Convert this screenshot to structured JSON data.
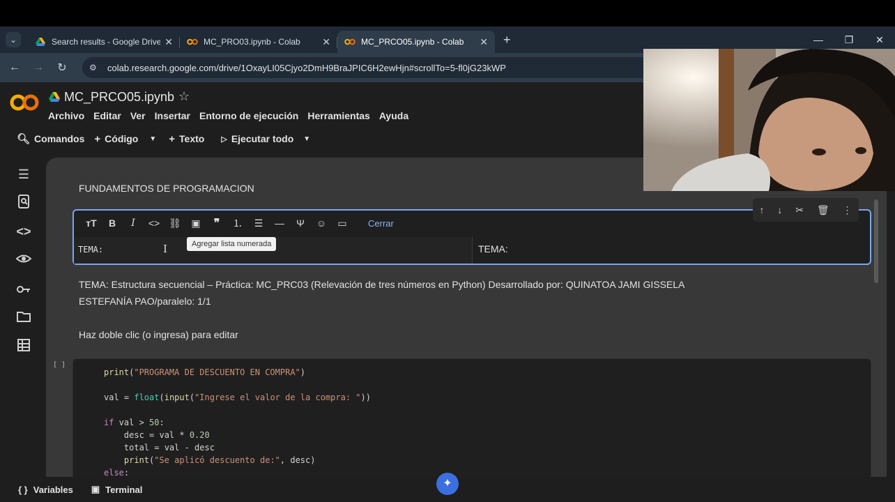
{
  "browser": {
    "tabs": [
      {
        "label": "Search results - Google Drive",
        "active": false
      },
      {
        "label": "MC_PRO03.ipynb - Colab",
        "active": false
      },
      {
        "label": "MC_PRCO05.ipynb - Colab",
        "active": true
      }
    ],
    "url": "colab.research.google.com/drive/1OxayLI05Cjyo2DmH9BraJPIC6H2ewHjn#scrollTo=5-fl0jG23kWP"
  },
  "colab": {
    "notebook_title": "MC_PRCO05.ipynb",
    "menu": [
      "Archivo",
      "Editar",
      "Ver",
      "Insertar",
      "Entorno de ejecución",
      "Herramientas",
      "Ayuda"
    ],
    "toolbar": {
      "commands": "Comandos",
      "code": "Código",
      "text": "Texto",
      "run_all": "Ejecutar todo"
    }
  },
  "notebook": {
    "heading": "FUNDAMENTOS DE PROGRAMACION",
    "editor": {
      "close_label": "Cerrar",
      "tooltip": "Agregar lista numerada",
      "source_text": "TEMA:",
      "preview_text": "TEMA:"
    },
    "text_cell_line1": "TEMA: Estructura secuencial – Práctica: MC_PRC03 (Relevación de tres números en Python) Desarrollado por: QUINATOA JAMI GISSELA",
    "text_cell_line2": "ESTEFANÍA PAO/paralelo: 1/1",
    "double_click_hint": "Haz doble clic (o ingresa) para editar",
    "run_indicator": "[ ]"
  },
  "statusbar": {
    "variables": "Variables",
    "terminal": "Terminal"
  }
}
